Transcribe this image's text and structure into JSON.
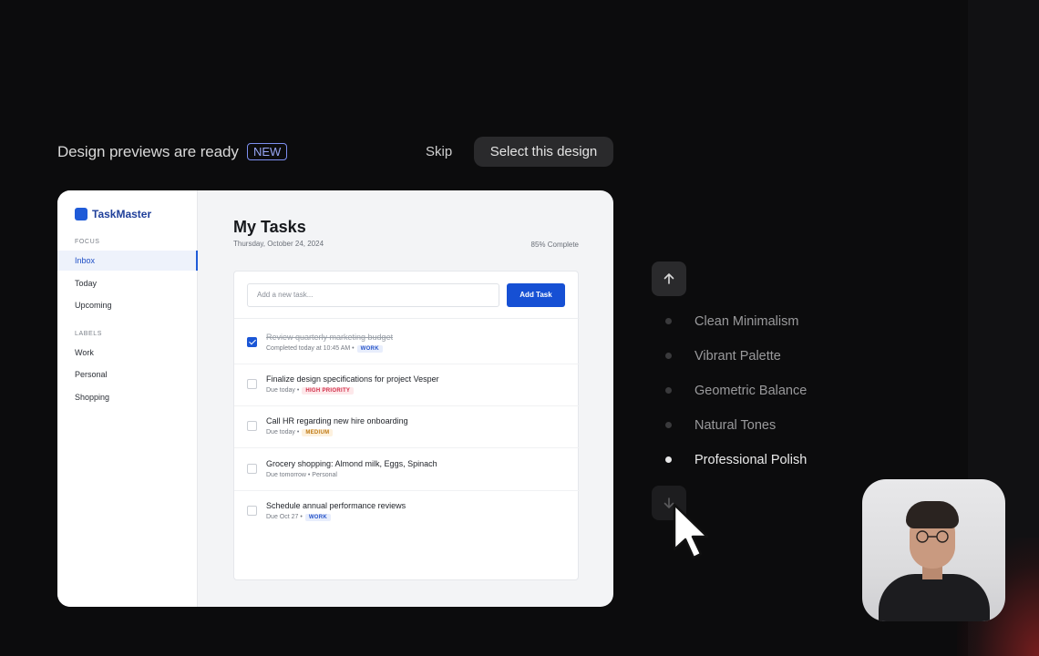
{
  "header": {
    "title": "Design previews are ready",
    "badge": "NEW",
    "skip_label": "Skip",
    "select_label": "Select this design"
  },
  "preview": {
    "brand": "TaskMaster",
    "sidebar": {
      "focus_label": "FOCUS",
      "focus_items": [
        "Inbox",
        "Today",
        "Upcoming"
      ],
      "labels_label": "LABELS",
      "label_items": [
        "Work",
        "Personal",
        "Shopping"
      ]
    },
    "main": {
      "title": "My Tasks",
      "date": "Thursday, October 24, 2024",
      "progress": "85% Complete",
      "input_placeholder": "Add a new task...",
      "add_label": "Add Task",
      "tasks": [
        {
          "title": "Review quarterly marketing budget",
          "meta": "Completed today at 10:45 AM •",
          "tag": "WORK",
          "done": true
        },
        {
          "title": "Finalize design specifications for project Vesper",
          "meta": "Due today •",
          "tag": "HIGH PRIORITY",
          "done": false
        },
        {
          "title": "Call HR regarding new hire onboarding",
          "meta": "Due today •",
          "tag": "MEDIUM",
          "done": false
        },
        {
          "title": "Grocery shopping: Almond milk, Eggs, Spinach",
          "meta": "Due tomorrow • Personal",
          "tag": "",
          "done": false
        },
        {
          "title": "Schedule annual performance reviews",
          "meta": "Due Oct 27 •",
          "tag": "WORK",
          "done": false
        }
      ]
    }
  },
  "designs": {
    "up_icon": "arrow-up-icon",
    "down_icon": "arrow-down-icon",
    "options": [
      "Clean Minimalism",
      "Vibrant Palette",
      "Geometric Balance",
      "Natural Tones",
      "Professional Polish"
    ],
    "selected": "Professional Polish"
  },
  "colors": {
    "accent": "#1650d4",
    "background": "#0c0c0d"
  }
}
